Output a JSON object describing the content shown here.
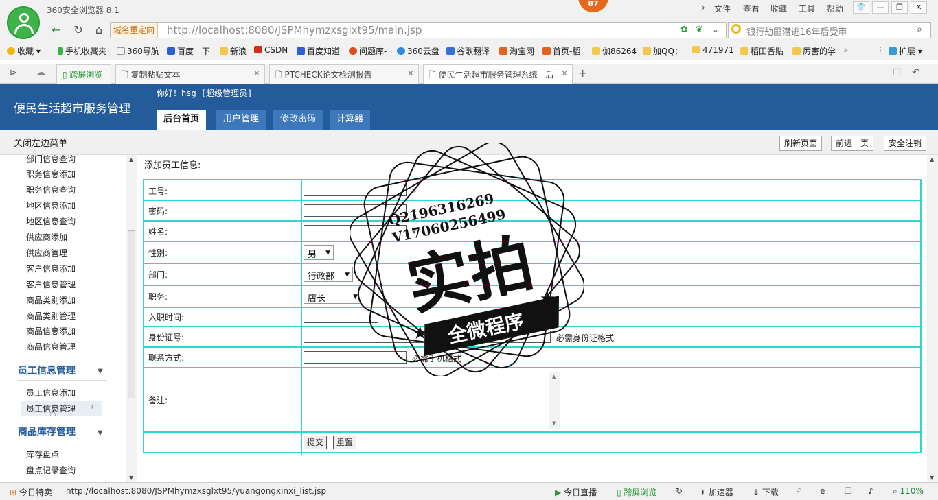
{
  "browser": {
    "title": "360安全浏览器 8.1",
    "badge": "87",
    "menu": [
      "文件",
      "查看",
      "收藏",
      "工具",
      "帮助"
    ],
    "redirect_label": "域名重定向",
    "url": "http://localhost:8080/JSPMhymzxsglxt95/main.jsp",
    "search_placeholder": "银行劫匪潜逃16年后受审",
    "bookmarks": [
      "收藏",
      "手机收藏夹",
      "360导航",
      "百度一下",
      "新浪",
      "CSDN",
      "百度知道",
      "问题库-",
      "360云盘",
      "谷歌翻译",
      "淘宝网",
      "首页-稻",
      "伽86264",
      "加QQ：",
      "471971",
      "稻田香贴",
      "厉害的学",
      "扩展"
    ],
    "tabs": [
      "跨屏浏览",
      "复制粘贴文本",
      "PTCHECK论文检测报告",
      "便民生活超市服务管理系统 - 后"
    ]
  },
  "app": {
    "system_title": "便民生活超市服务管理",
    "greeting": "你好！hsg [超级管理员]",
    "nav": [
      "后台首页",
      "用户管理",
      "修改密码",
      "计算器"
    ],
    "close_left_menu": "关闭左边菜单",
    "actions": [
      "刷新页面",
      "前进一页",
      "安全注销"
    ]
  },
  "sidebar": {
    "items_top": [
      "部门信息查询",
      "职务信息添加",
      "职务信息查询",
      "地区信息添加",
      "地区信息查询",
      "供应商添加",
      "供应商管理",
      "客户信息添加",
      "客户信息管理",
      "商品类别添加",
      "商品类别管理",
      "商品信息添加",
      "商品信息管理"
    ],
    "group_employee": "员工信息管理",
    "employee_items": [
      "员工信息添加",
      "员工信息管理"
    ],
    "group_stock": "商品库存管理",
    "stock_items": [
      "库存盘点",
      "盘点记录查询"
    ]
  },
  "form": {
    "title": "添加员工信息:",
    "labels": {
      "id": "工号:",
      "password": "密码:",
      "name": "姓名:",
      "gender": "性别:",
      "dept": "部门:",
      "position": "职务:",
      "hire_date": "入职时间:",
      "id_card": "身份证号:",
      "contact": "联系方式:",
      "remark": "备注:"
    },
    "required_mark": "*",
    "gender_value": "男",
    "dept_value": "行政部",
    "position_value": "店长",
    "id_card_hint": "必需身份证格式",
    "contact_hint": "必需手机格式",
    "submit": "提交",
    "reset": "重置"
  },
  "stamp": {
    "line1": "Q2196316269",
    "line2": "V17060256499",
    "big": "实拍",
    "banner": "全微程序"
  },
  "status": {
    "today": "今日特卖",
    "url": "http://localhost:8080/JSPMhymzxsglxt95/yuangongxinxi_list.jsp",
    "live": "今日直播",
    "cross": "跨屏浏览",
    "accel": "加速器",
    "download": "下载",
    "zoom": "110%"
  }
}
